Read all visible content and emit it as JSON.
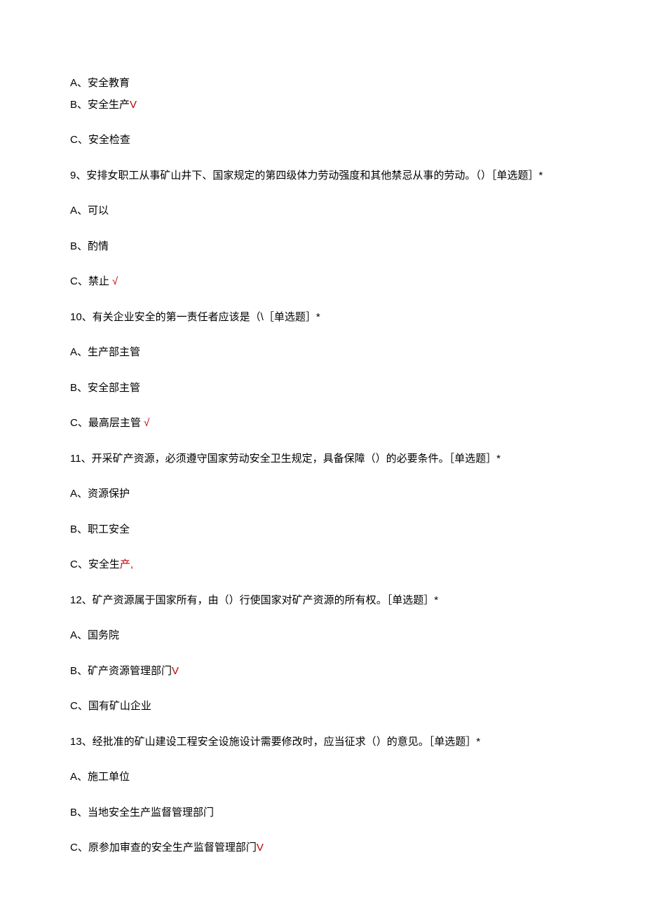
{
  "q8": {
    "a": "A、安全教育",
    "b": "B、安全生产",
    "b_mark": "V",
    "c": "C、安全检查"
  },
  "q9": {
    "stem": "9、安排女职工从事矿山井下、国家规定的第四级体力劳动强度和其他禁忌从事的劳动。（）［单选题］*",
    "a": "A、可以",
    "b": "B、酌情",
    "c": "C、禁止",
    "c_mark": " √"
  },
  "q10": {
    "stem": "10、有关企业安全的第一责任者应该是（\\［单选题］*",
    "a": "A、生产部主管",
    "b": "B、安全部主管",
    "c": "C、最高层主管",
    "c_mark": " √"
  },
  "q11": {
    "stem": "11、开采矿产资源，必须遵守国家劳动安全卫生规定，具备保障（）的必要条件。［单选题］*",
    "a": "A、资源保护",
    "b": "B、职工安全",
    "c": "C、安全生",
    "c_mark": "产,"
  },
  "q12": {
    "stem": "12、矿产资源属于国家所有，由（）行使国家对矿产资源的所有权。［单选题］*",
    "a": "A、国务院",
    "b": "B、矿产资源管理部门",
    "b_mark": "V",
    "c": "C、国有矿山企业"
  },
  "q13": {
    "stem": "13、经批准的矿山建设工程安全设施设计需要修改时，应当征求（）的意见。［单选题］*",
    "a": "A、施工单位",
    "b": "B、当地安全生产监督管理部门",
    "c": "C、原参加审查的安全生产监督管理部门",
    "c_mark": "V"
  }
}
